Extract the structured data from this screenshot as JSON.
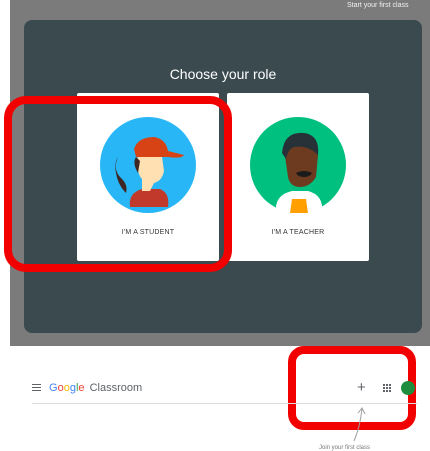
{
  "top_hint": "Start your first class",
  "dialog": {
    "title": "Choose your role",
    "roles": [
      {
        "label": "I'M A STUDENT",
        "icon": "student-avatar-icon"
      },
      {
        "label": "I'M A TEACHER",
        "icon": "teacher-avatar-icon"
      }
    ]
  },
  "appbar": {
    "logo_google": "Google",
    "logo_product": "Classroom",
    "create_symbol": "+"
  },
  "join_hint": "Join your first class",
  "colors": {
    "dialog_bg": "#3b4a4f",
    "highlight": "#f20000",
    "student_circle": "#29b6f6",
    "teacher_circle": "#00c07f"
  }
}
